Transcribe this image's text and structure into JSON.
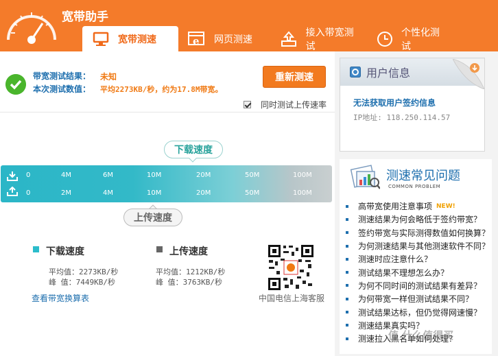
{
  "app": {
    "title": "宽带助手"
  },
  "tabs": [
    {
      "label": "宽带测速",
      "icon": "monitor-icon",
      "active": true
    },
    {
      "label": "网页测速",
      "icon": "browser-icon",
      "active": false
    },
    {
      "label": "接入带宽测试",
      "icon": "upload-tray-icon",
      "active": false
    },
    {
      "label": "个性化测试",
      "icon": "clock-icon",
      "active": false
    }
  ],
  "result": {
    "bandwidth_label": "带宽测试结果：",
    "bandwidth_value": "未知",
    "current_label": "本次测试数值：",
    "current_value": "平均2273KB/秒，约为17.8M带宽。",
    "retest_label": "重新测速",
    "upload_checkbox_label": "同时测试上传速率",
    "upload_checkbox_checked": true
  },
  "gauge": {
    "download_label": "下载速度",
    "upload_label": "上传速度",
    "download_ticks": [
      "0",
      "4M",
      "6M",
      "10M",
      "20M",
      "50M",
      "100M"
    ],
    "upload_ticks": [
      "0",
      "2M",
      "4M",
      "10M",
      "20M",
      "50M",
      "100M"
    ]
  },
  "stats": {
    "download_title": "下载速度",
    "download_avg": "平均值：2273KB/秒",
    "download_peak": "峰  值：7449KB/秒",
    "upload_title": "上传速度",
    "upload_avg": "平均值：1212KB/秒",
    "upload_peak": "峰  值：3763KB/秒",
    "download_color": "#2bbccb",
    "upload_color": "#666666",
    "link": "查看带宽换算表",
    "qr_caption": "中国电信上海客服"
  },
  "user": {
    "title": "用户信息",
    "name": "无法获取用户签约信息",
    "ip": "IP地址: 118.250.114.57"
  },
  "faq": {
    "title": "测速常见问题",
    "subtitle": "COMMON PROBLEM",
    "items": [
      "高带宽使用注意事项",
      "测速结果为何会略低于签约带宽？",
      "签约带宽与实际测得数值如何换算？",
      "为何测速结果与其他测速软件不同？",
      "测速时应注意什么？",
      "测试结果不理想怎么办？",
      "为何不同时间的测试结果有差异？",
      "为何带宽一样但测试结果不同？",
      "测试结果达标，但仍觉得网速慢？",
      "测速结果真实吗？",
      "测速拉入黑名单如何处理？"
    ],
    "new_badge": "NEW!"
  },
  "watermark": "值 什么值得买",
  "colors": {
    "brand": "#f47b2a",
    "accent_blue": "#1e6fae",
    "teal": "#2bb6c7"
  }
}
